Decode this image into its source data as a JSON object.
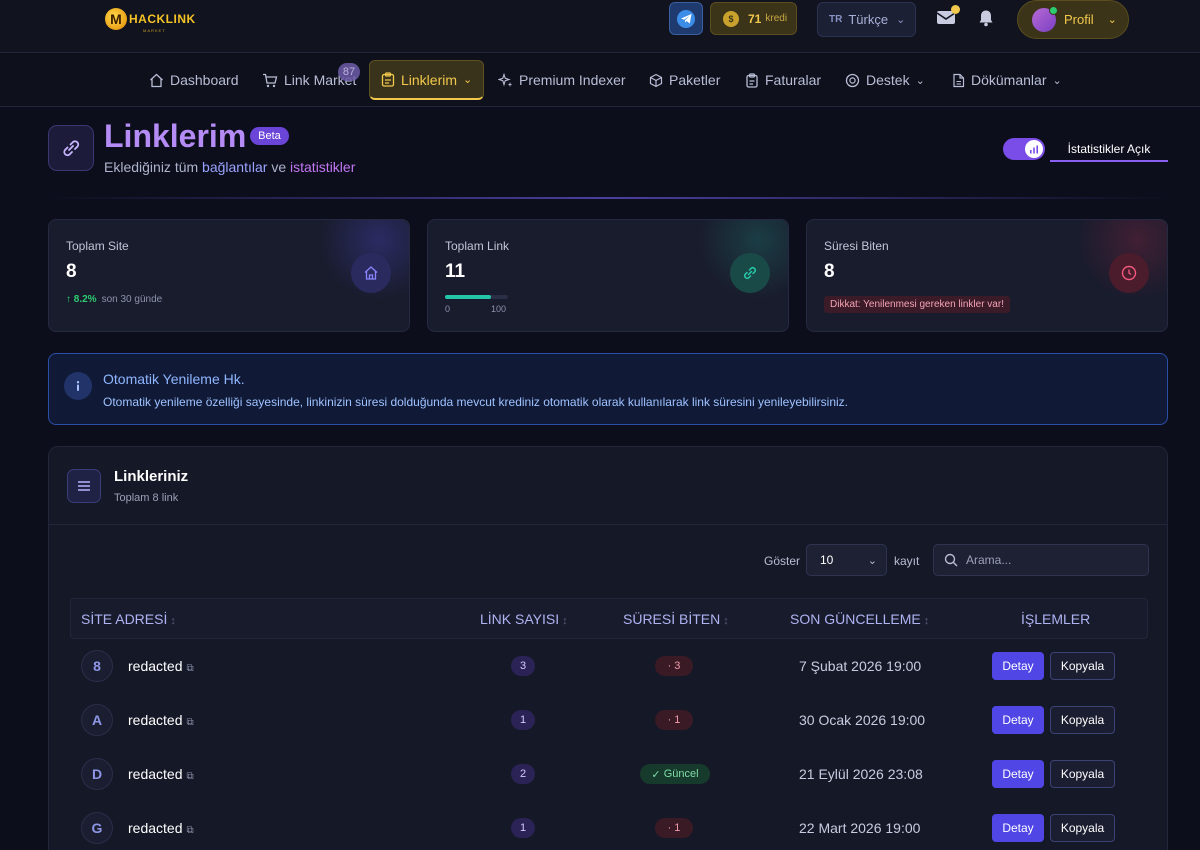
{
  "brand": {
    "logo_text": "HACKLINK",
    "logo_sub": "MARKET"
  },
  "topbar": {
    "credits": "71",
    "credits_unit": "kredi",
    "lang_code": "TR",
    "lang_label": "Türkçe",
    "profile_label": "Profil"
  },
  "nav": {
    "items": [
      {
        "label": "Dashboard",
        "icon": "home-icon"
      },
      {
        "label": "Link Market",
        "icon": "cart-icon",
        "badge": "87"
      },
      {
        "label": "Linklerim",
        "icon": "clipboard-icon",
        "active": true
      },
      {
        "label": "Premium Indexer",
        "icon": "sparkle-icon"
      },
      {
        "label": "Paketler",
        "icon": "package-icon"
      },
      {
        "label": "Faturalar",
        "icon": "invoice-icon"
      },
      {
        "label": "Destek",
        "icon": "support-icon"
      },
      {
        "label": "Dökümanlar",
        "icon": "document-icon"
      }
    ]
  },
  "header": {
    "title": "Linklerim",
    "badge": "Beta",
    "subtitle_prefix": "Eklediğiniz tüm",
    "subtitle_link1": "bağlantılar",
    "subtitle_mid": "ve",
    "subtitle_link2": "istatistikler",
    "stats_toggle_label": "İstatistikler Açık"
  },
  "stats": [
    {
      "label": "Toplam Site",
      "value": "8",
      "trend": "8.2%",
      "trend_note": "son 30 günde"
    },
    {
      "label": "Toplam Link",
      "value": "11",
      "progress": 0.73,
      "progress_min": "0",
      "progress_max": "100"
    },
    {
      "label": "Süresi Biten",
      "value": "8",
      "warning": "Dikkat: Yenilenmesi gereken linkler var!"
    }
  ],
  "info": {
    "title": "Otomatik Yenileme Hk.",
    "text": "Otomatik yenileme özelliği sayesinde, linkinizin süresi dolduğunda mevcut krediniz otomatik olarak kullanılarak link süresini yenileyebilirsiniz."
  },
  "panel": {
    "title": "Linkleriniz",
    "subtitle": "Toplam 8 link",
    "show_label": "Göster",
    "page_size": "10",
    "records_label": "kayıt",
    "search_placeholder": "Arama..."
  },
  "table": {
    "columns": [
      "SİTE ADRESİ",
      "LİNK SAYISI",
      "SÜRESİ BİTEN",
      "SON GÜNCELLEME",
      "İŞLEMLER"
    ],
    "rows": [
      {
        "initial": "8",
        "site": "redacted",
        "links": "3",
        "expired": "3",
        "updated": "7 Şubat 2026 19:00"
      },
      {
        "initial": "A",
        "site": "redacted",
        "links": "1",
        "expired": "1",
        "updated": "30 Ocak 2026 19:00"
      },
      {
        "initial": "D",
        "site": "redacted",
        "links": "2",
        "expired": "Güncel",
        "updated": "21 Eylül 2026 23:08"
      },
      {
        "initial": "G",
        "site": "redacted",
        "links": "1",
        "expired": "1",
        "updated": "22 Mart 2026 19:00"
      }
    ],
    "detail_label": "Detay",
    "copy_label": "Kopyala"
  }
}
